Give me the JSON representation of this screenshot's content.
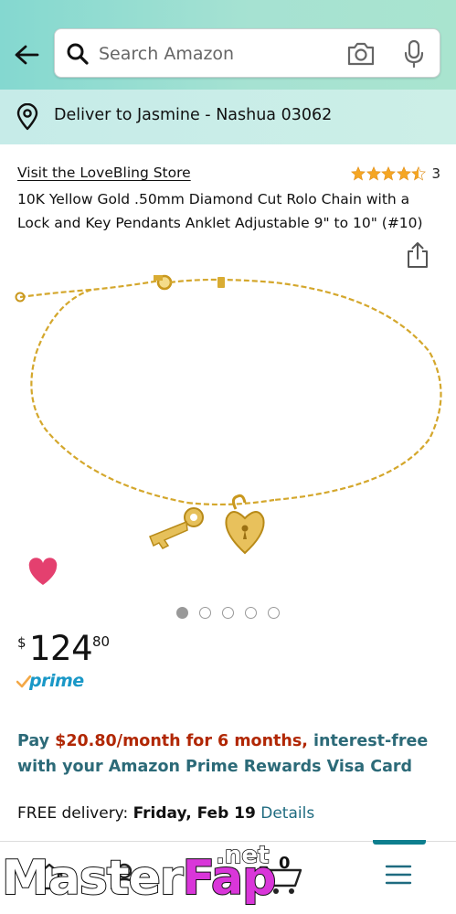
{
  "header": {
    "back_icon": "back-arrow-icon",
    "search": {
      "placeholder": "Search Amazon",
      "value": ""
    },
    "camera_icon": "camera-icon",
    "mic_icon": "microphone-icon"
  },
  "location": {
    "icon": "location-pin-icon",
    "text": "Deliver to Jasmine - Nashua 03062"
  },
  "product": {
    "store_link": "Visit the LoveBling Store",
    "rating": {
      "stars": 4.5,
      "count": "3"
    },
    "title": "10K Yellow Gold .50mm Diamond Cut Rolo Chain with a Lock and Key Pendants Anklet Adjustable 9\" to 10\" (#10)",
    "image_alt": "gold anklet with key and heart lock pendants",
    "image_count": 5,
    "active_image": 1,
    "price": {
      "currency": "$",
      "whole": "124",
      "fraction": "80"
    },
    "prime_label": "prime",
    "promo": {
      "prefix": "Pay ",
      "amount": "$20.80/month for 6 months,",
      "suffix": " interest-free with your Amazon Prime Rewards Visa Card"
    },
    "delivery": {
      "prefix": "FREE delivery: ",
      "date": "Friday, Feb 19",
      "details": "Details"
    }
  },
  "bottom_nav": {
    "cart_count": "0",
    "items": [
      "home-icon",
      "account-icon",
      "cart-icon",
      "menu-icon"
    ]
  },
  "watermark": {
    "main": "MasterFap",
    "suffix": ".net"
  },
  "colors": {
    "header_gradient_start": "#84d8d0",
    "header_gradient_end": "#a9e4cf",
    "deliver_bar": "#c6ebe8",
    "promo_text": "#2c6a78",
    "promo_amount": "#b12704",
    "prime_blue": "#1a98c7",
    "prime_check": "#f3a847",
    "star": "#f5a623",
    "wishlist_heart": "#e4406f",
    "gold": "#d4a72c",
    "link": "#1f6b80"
  }
}
